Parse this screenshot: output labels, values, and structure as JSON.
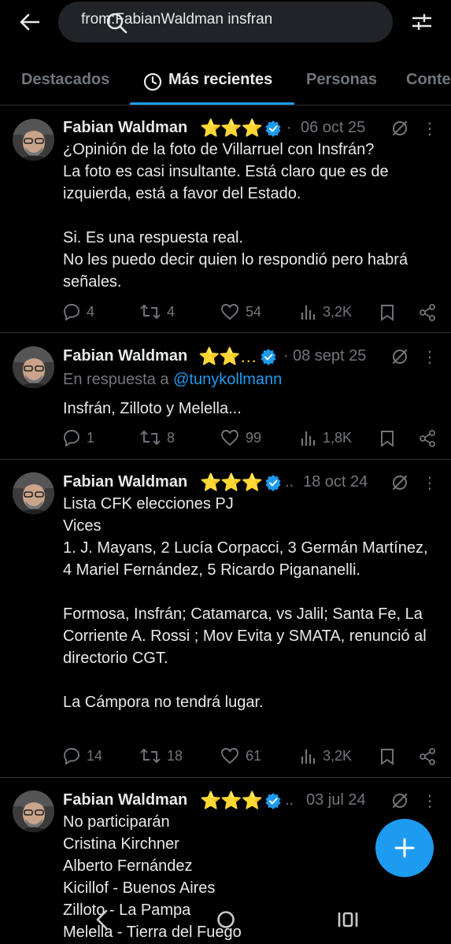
{
  "search": {
    "query": "from:FabianWaldman insfran"
  },
  "tabs": [
    {
      "label": "Destacados"
    },
    {
      "label": "Más recientes"
    },
    {
      "label": "Personas"
    },
    {
      "label": "Conte"
    }
  ],
  "colors": {
    "accent": "#1d9bf0",
    "background": "#000000",
    "star": "#ffd42a",
    "muted": "#71767b"
  },
  "tweets": [
    {
      "name": "Fabian Waldman",
      "stars": "⭐⭐⭐",
      "dots": "·",
      "date": "06 oct 25",
      "body": "¿Opinión de la foto de Villarruel con Insfrán?\nLa foto es casi insultante. Está claro que es de izquierda, está a favor del Estado.\n\nSi. Es una respuesta real.\nNo les puedo decir quien lo respondió pero habrá señales.",
      "replies": "4",
      "reposts": "4",
      "likes": "54",
      "views": "3,2K"
    },
    {
      "name": "Fabian Waldman",
      "stars": "⭐⭐…",
      "dots": "·",
      "date": "08 sept 25",
      "reply_prefix": "En respuesta a",
      "reply_handle": "@tunykollmann",
      "body": "Insfrán, Zilloto y Melella...",
      "replies": "1",
      "reposts": "8",
      "likes": "99",
      "views": "1,8K"
    },
    {
      "name": "Fabian Waldman",
      "stars": "⭐⭐⭐",
      "dots": "..",
      "date": "18 oct 24",
      "body": "Lista CFK elecciones PJ\nVices\n1. J. Mayans, 2 Lucía Corpacci, 3 Germán Martínez, 4 Mariel Fernández, 5 Ricardo Pigananelli.\n\nFormosa, Insfrán; Catamarca, vs Jalil; Santa Fe, La Corriente A. Rossi ; Mov Evita y SMATA, renunció al directorio CGT.\n\nLa Cámpora no tendrá lugar.",
      "replies": "14",
      "reposts": "18",
      "likes": "61",
      "views": "3,2K"
    },
    {
      "name": "Fabian Waldman",
      "stars": "⭐⭐⭐",
      "dots": "..",
      "date": "03 jul 24",
      "body": "No participarán\nCristina Kirchner\nAlberto Fernández\nKicillof - Buenos Aires\nZilloto - La Pampa\nMelella - Tierra del Fuego"
    }
  ]
}
